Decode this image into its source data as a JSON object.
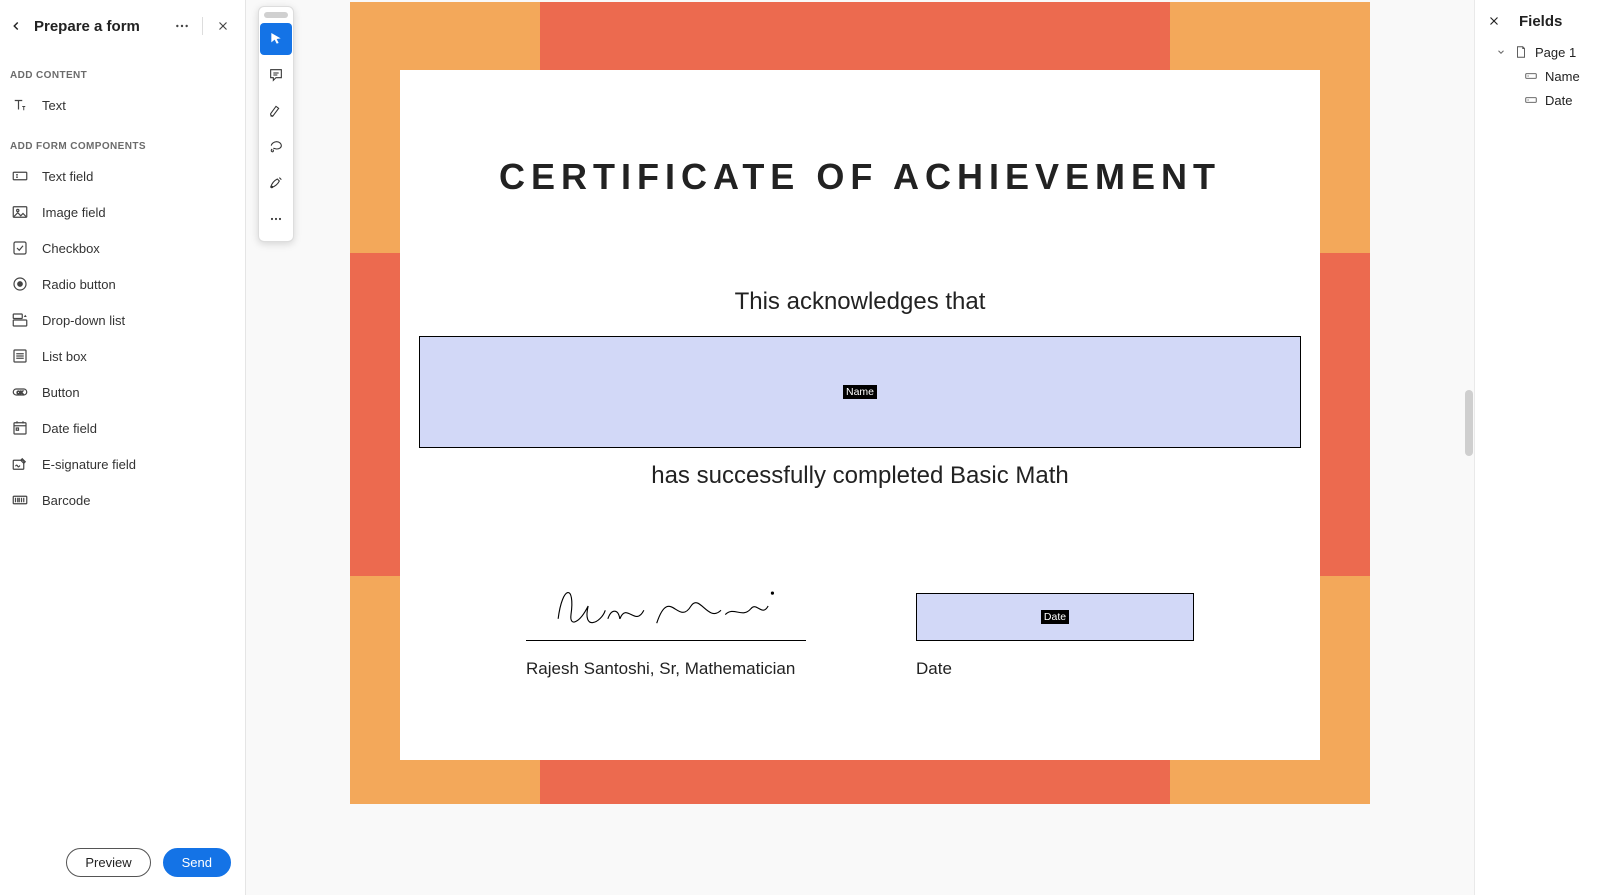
{
  "leftPanel": {
    "title": "Prepare a form",
    "sectionContent": "ADD CONTENT",
    "sectionForm": "ADD FORM COMPONENTS",
    "items": {
      "text": "Text",
      "textField": "Text field",
      "imageField": "Image field",
      "checkbox": "Checkbox",
      "radio": "Radio button",
      "dropdown": "Drop-down list",
      "listbox": "List box",
      "button": "Button",
      "dateField": "Date field",
      "esign": "E-signature field",
      "barcode": "Barcode"
    },
    "previewBtn": "Preview",
    "sendBtn": "Send"
  },
  "document": {
    "title": "CERTIFICATE OF ACHIEVEMENT",
    "ack": "This acknowledges that",
    "completed": "has successfully completed Basic Math",
    "signer": "Rajesh Santoshi, Sr, Mathematician",
    "dateLabel": "Date",
    "fields": {
      "name": "Name",
      "date": "Date"
    }
  },
  "rightPanel": {
    "title": "Fields",
    "page": "Page 1",
    "fieldName": "Name",
    "fieldDate": "Date"
  }
}
